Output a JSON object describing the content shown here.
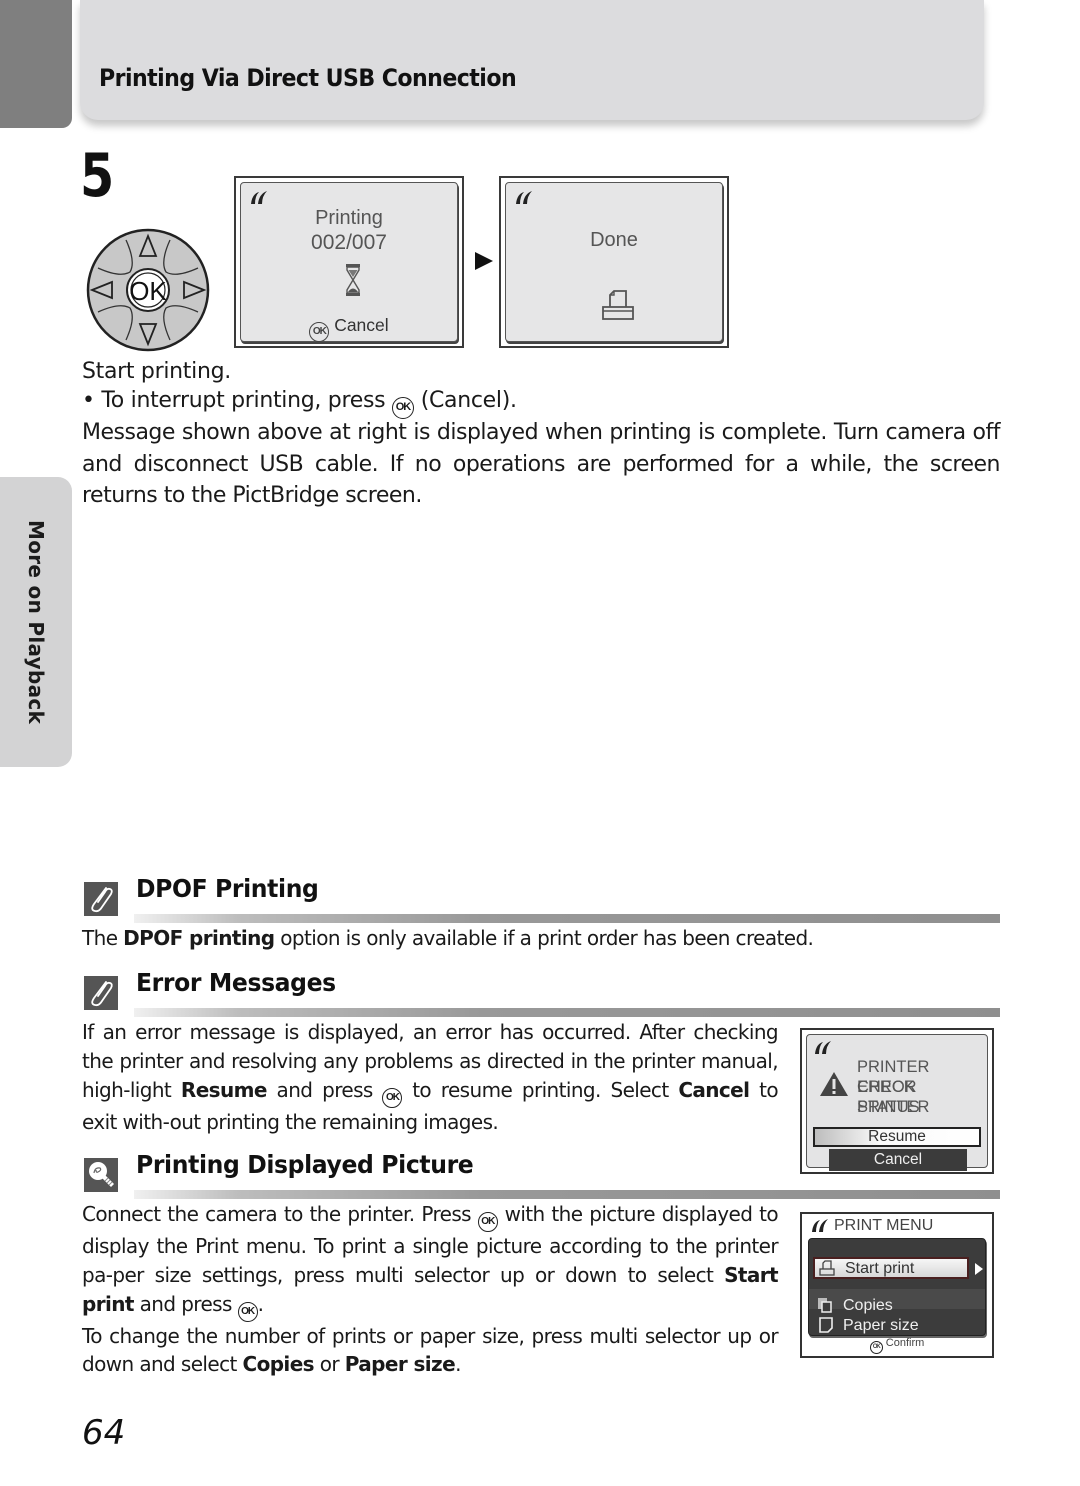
{
  "header": {
    "title": "Printing Via Direct USB Connection"
  },
  "side_tab": {
    "label": "More on Playback"
  },
  "step": {
    "number": "5",
    "multi_selector": {
      "center_label": "OK"
    },
    "screens": [
      {
        "line1": "Printing",
        "line2": "002/007",
        "footer_glyph": "OK",
        "footer_label": "Cancel",
        "icon": "hourglass-icon"
      },
      {
        "line1": "Done",
        "icon": "printer-icon"
      }
    ],
    "instruction": "Start printing.",
    "bullet": {
      "before": "To interrupt printing, press",
      "glyph": "OK",
      "after": "(Cancel)."
    },
    "paragraph": "Message shown above at right is displayed when printing is complete. Turn camera off and disconnect USB cable. If no operations are performed for a while, the screen returns to the PictBridge screen."
  },
  "sections": [
    {
      "title": "DPOF Printing",
      "icon": "paperclip-icon",
      "text": {
        "pre": "The",
        "bold1": "DPOF printing",
        "post": "option is only available if a print order has been created."
      }
    },
    {
      "title": "Error Messages",
      "icon": "paperclip-icon",
      "text": {
        "p1": "If an error message is displayed, an error has occurred. After checking the printer and resolving any problems as directed in the printer manual, high-light",
        "bold1": "Resume",
        "p2": "and press",
        "glyph": "OK",
        "p3": "to resume printing. Select",
        "bold2": "Cancel",
        "p4": "to exit with-out printing the remaining images."
      },
      "screen": {
        "lines": [
          "PRINTER ERROR",
          "CHECK PRINTER",
          "STATUS"
        ],
        "options": [
          "Resume",
          "Cancel"
        ],
        "selected": "Resume"
      }
    },
    {
      "title": "Printing Displayed Picture",
      "icon": "lightbulb-tip-icon",
      "text": {
        "p1": "Connect the camera to the printer. Press",
        "glyph": "OK",
        "p2": "with the picture displayed to display the Print menu. To print a single picture according to the printer pa-per size settings, press multi selector up or down to select",
        "bold1": "Start print",
        "p3": "and press",
        "p4": ".",
        "p5": "To change the number of prints or paper size, press multi selector up or down and select",
        "bold2": "Copies",
        "p6": "or",
        "bold3": "Paper size",
        "p7": "."
      },
      "screen": {
        "title": "PRINT MENU",
        "items": [
          "Start print",
          "Copies",
          "Paper size"
        ],
        "selected": "Start print",
        "footer_glyph": "OK",
        "footer_label": "Confirm"
      }
    }
  ],
  "page_number": "64"
}
